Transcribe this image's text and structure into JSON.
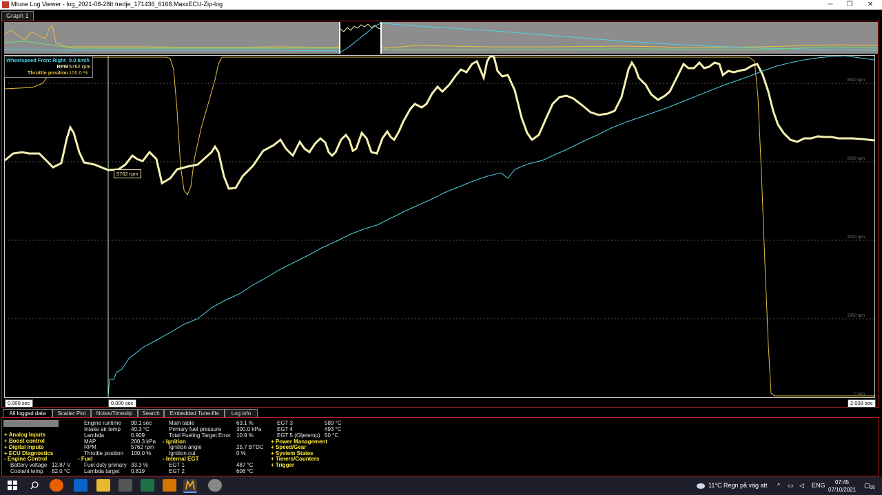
{
  "window": {
    "title": "Mtune Log Viewer - log_2021-08-28tt tredje_171436_6168.MaxxECU-Zip-log",
    "minimize_glyph": "─",
    "maximize_glyph": "❐",
    "close_glyph": "✕"
  },
  "graph_tab": {
    "label": "Graph 1"
  },
  "legend": [
    {
      "name": "Wheelspeed Front Right",
      "value": "0.0 km/h",
      "color": "#4fd3e4"
    },
    {
      "name": "RPM",
      "value": "5762 rpm",
      "color": "#f5f0b0"
    },
    {
      "name": "Throttle position",
      "value": "100.0 %",
      "color": "#e8c040"
    }
  ],
  "cursor_readout": "5762 rpm",
  "y_ticks": [
    "8000 rpm",
    "6000 rpm",
    "4000 rpm",
    "2000 rpm",
    "0 rpm"
  ],
  "time": {
    "start": "0.000 sec",
    "cursor": "0.000 sec",
    "end": "2.038 sec"
  },
  "bottom_tabs": [
    "All logged data",
    "Scatter Plot",
    "Notes/Timeslip",
    "Search",
    "Embedded Tune-file",
    "Log info"
  ],
  "search": {
    "placeholder": "search value"
  },
  "groups_col1": [
    "+ Analog Inputs",
    "+ Boost control",
    "+ Digital inputs",
    "+ ECU Diagnostics",
    "- Engine Control"
  ],
  "engine_control_fields": [
    {
      "name": "Battery voltage",
      "value": "12.87 V"
    },
    {
      "name": "Coolant temp",
      "value": "82.0 °C"
    }
  ],
  "fields_col2": [
    {
      "name": "Engine runtime",
      "value": "99.1 sec"
    },
    {
      "name": "Intake air temp",
      "value": "40.3 °C"
    },
    {
      "name": "Lambda",
      "value": "0.909"
    },
    {
      "name": "MAP",
      "value": "200.3 kPa"
    },
    {
      "name": "RPM",
      "value": "5762 rpm"
    },
    {
      "name": "Throttle position",
      "value": "100.0 %"
    }
  ],
  "fuel_group": "- Fuel",
  "fuel_fields": [
    {
      "name": "Fuel duty primary",
      "value": "33.3 %"
    },
    {
      "name": "Lambda target",
      "value": "0.819"
    }
  ],
  "fields_col3": [
    {
      "name": "Main table",
      "value": "63.1 %"
    },
    {
      "name": "Primary fuel pressure",
      "value": "300.0 kPa"
    },
    {
      "name": "Total Fueling Target Error",
      "value": "10.9 %"
    }
  ],
  "ignition_group": "- Ignition",
  "ignition_fields": [
    {
      "name": "Ignition angle",
      "value": "25.7 BTDC"
    },
    {
      "name": "Ignition cut",
      "value": "0 %"
    }
  ],
  "egt_group": "- Internal EGT",
  "egt_fields": [
    {
      "name": "EGT 1",
      "value": "487 °C"
    },
    {
      "name": "EGT 2",
      "value": "606 °C"
    }
  ],
  "fields_col4": [
    {
      "name": "EGT 3",
      "value": "589 °C"
    },
    {
      "name": "EGT 4",
      "value": "493 °C"
    },
    {
      "name": "EGT 5 (Oljetemp)",
      "value": "50 °C"
    }
  ],
  "groups_col4": [
    "+ Power Management",
    "+ Speed/Gear",
    "+ System States",
    "+ Timers/Counters",
    "+ Trigger"
  ],
  "taskbar": {
    "weather": "11°C  Regn på väg att",
    "language": "ENG",
    "time": "07:45",
    "date": "07/10/2021",
    "notifications": "16"
  },
  "colors": {
    "rpm": "#f5f0b0",
    "throttle": "#e8c040",
    "wheelspeed": "#4fd3e4",
    "frame": "#b22222",
    "group_text": "#ffeb3b"
  }
}
